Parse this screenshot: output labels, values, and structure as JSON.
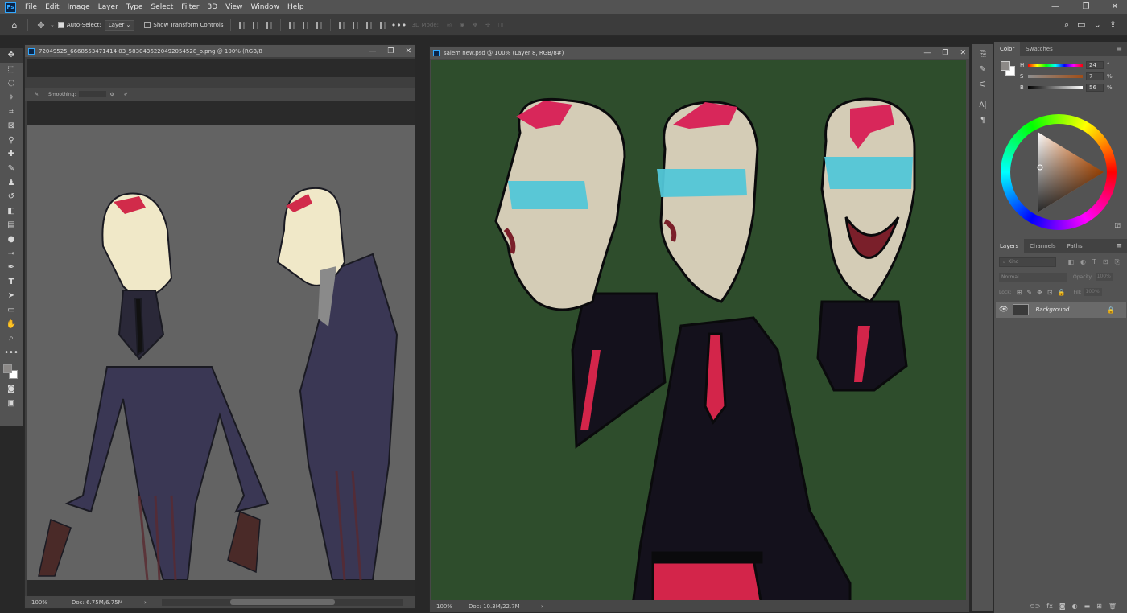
{
  "app": {
    "logo": "Ps"
  },
  "menu": [
    "File",
    "Edit",
    "Image",
    "Layer",
    "Type",
    "Select",
    "Filter",
    "3D",
    "View",
    "Window",
    "Help"
  ],
  "options": {
    "auto_select_label": "Auto-Select:",
    "auto_select_value": "Layer",
    "show_transform_label": "Show Transform Controls",
    "mode_3d_label": "3D Mode:"
  },
  "doc1": {
    "title": "72049525_6668553471414 03_5830436220492054528_o.png @ 100% (RGB/8",
    "smoothing_label": "Smoothing:",
    "zoom": "100%",
    "doc_size": "Doc: 6.75M/6.75M"
  },
  "doc2": {
    "title": "salem new.psd @ 100% (Layer 8, RGB/8#)",
    "zoom": "100%",
    "doc_size": "Doc: 10.3M/22.7M"
  },
  "color_panel": {
    "tabs": [
      "Color",
      "Swatches"
    ],
    "h": {
      "label": "H",
      "value": "24",
      "unit": "°"
    },
    "s": {
      "label": "S",
      "value": "7",
      "unit": "%"
    },
    "b": {
      "label": "B",
      "value": "56",
      "unit": "%"
    }
  },
  "layers_panel": {
    "tabs": [
      "Layers",
      "Channels",
      "Paths"
    ],
    "kind_placeholder": "Kind",
    "blend_mode": "Normal",
    "opacity_label": "Opacity:",
    "opacity_value": "100%",
    "lock_label": "Lock:",
    "fill_label": "Fill:",
    "fill_value": "100%",
    "layers": [
      {
        "name": "Background",
        "visible": true,
        "locked": true
      }
    ]
  },
  "colors": {
    "accent": "#31a8ff",
    "ui": "#535353",
    "canvas_green": "#2e4d2c",
    "sketch_gray": "#636363"
  }
}
